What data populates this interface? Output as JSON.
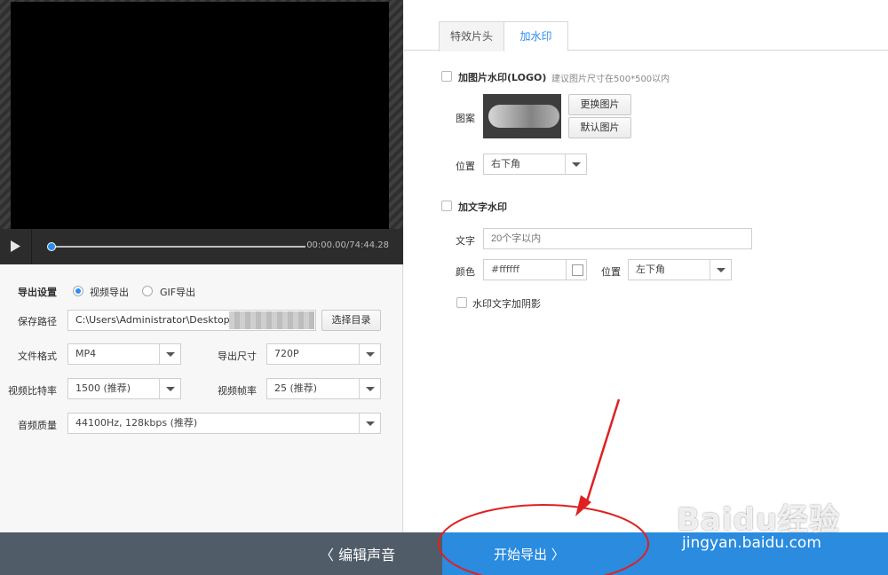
{
  "player": {
    "timecode": "00:00.00/74:44.28"
  },
  "export_settings": {
    "heading": "导出设置",
    "radio_video": "视频导出",
    "radio_gif": "GIF导出",
    "save_path_label": "保存路径",
    "save_path_value": "C:\\Users\\Administrator\\Desktop",
    "choose_dir_button": "选择目录",
    "format_label": "文件格式",
    "format_value": "MP4",
    "size_label": "导出尺寸",
    "size_value": "720P",
    "bitrate_label": "视频比特率",
    "bitrate_value": "1500 (推荐)",
    "framerate_label": "视频帧率",
    "framerate_value": "25 (推荐)",
    "audio_label": "音频质量",
    "audio_value": "44100Hz, 128kbps (推荐)"
  },
  "tabs": [
    {
      "label": "特效片头",
      "active": false
    },
    {
      "label": "加水印",
      "active": true
    }
  ],
  "watermark": {
    "logo_checkbox_label": "加图片水印(LOGO)",
    "logo_hint": "建议图片尺寸在500*500以内",
    "pattern_label": "图案",
    "replace_image_button": "更换图片",
    "default_image_button": "默认图片",
    "position_label": "位置",
    "position_value": "右下角",
    "text_checkbox_label": "加文字水印",
    "text_label": "文字",
    "text_placeholder": "20个字以内",
    "color_label": "颜色",
    "color_value": "#ffffff",
    "text_position_label": "位置",
    "text_position_value": "左下角",
    "shadow_checkbox_label": "水印文字加阴影"
  },
  "footer": {
    "edit_audio_label": "编辑声音",
    "start_export_label": "开始导出"
  },
  "brand_watermark": {
    "logo_text": "Baidu经验",
    "url": "jingyan.baidu.com"
  },
  "colors": {
    "accent": "#2d8cf0",
    "footer_blue": "#2a8bdf",
    "footer_gray": "#505c68",
    "annotation_red": "#e02020"
  }
}
